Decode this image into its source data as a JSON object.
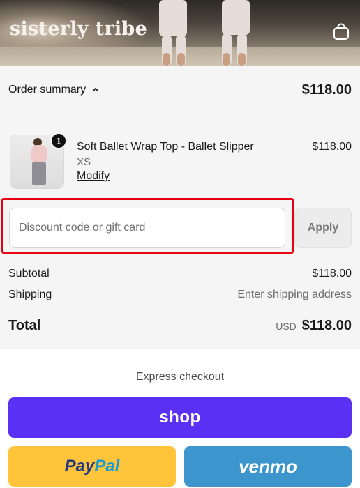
{
  "header": {
    "brand": "sisterly tribe",
    "cart_icon": "shopping-bag-icon"
  },
  "summary": {
    "toggle_label": "Order summary",
    "toggle_icon": "chevron-up-icon",
    "total": "$118.00"
  },
  "item": {
    "quantity": "1",
    "title": "Soft Ballet Wrap Top - Ballet Slipper",
    "variant": "XS",
    "modify_label": "Modify",
    "price": "$118.00"
  },
  "discount": {
    "placeholder": "Discount code or gift card",
    "value": "",
    "apply_label": "Apply"
  },
  "totals": {
    "subtotal_label": "Subtotal",
    "subtotal_value": "$118.00",
    "shipping_label": "Shipping",
    "shipping_value": "Enter shipping address",
    "total_label": "Total",
    "currency": "USD",
    "total_value": "$118.00"
  },
  "express": {
    "title": "Express checkout",
    "shop_label": "shop",
    "paypal_part1": "Pay",
    "paypal_part2": "Pal",
    "venmo_label": "venmo"
  },
  "colors": {
    "highlight": "#e60012",
    "shop": "#5a31f4",
    "paypal": "#ffc439",
    "venmo": "#3d95ce"
  }
}
